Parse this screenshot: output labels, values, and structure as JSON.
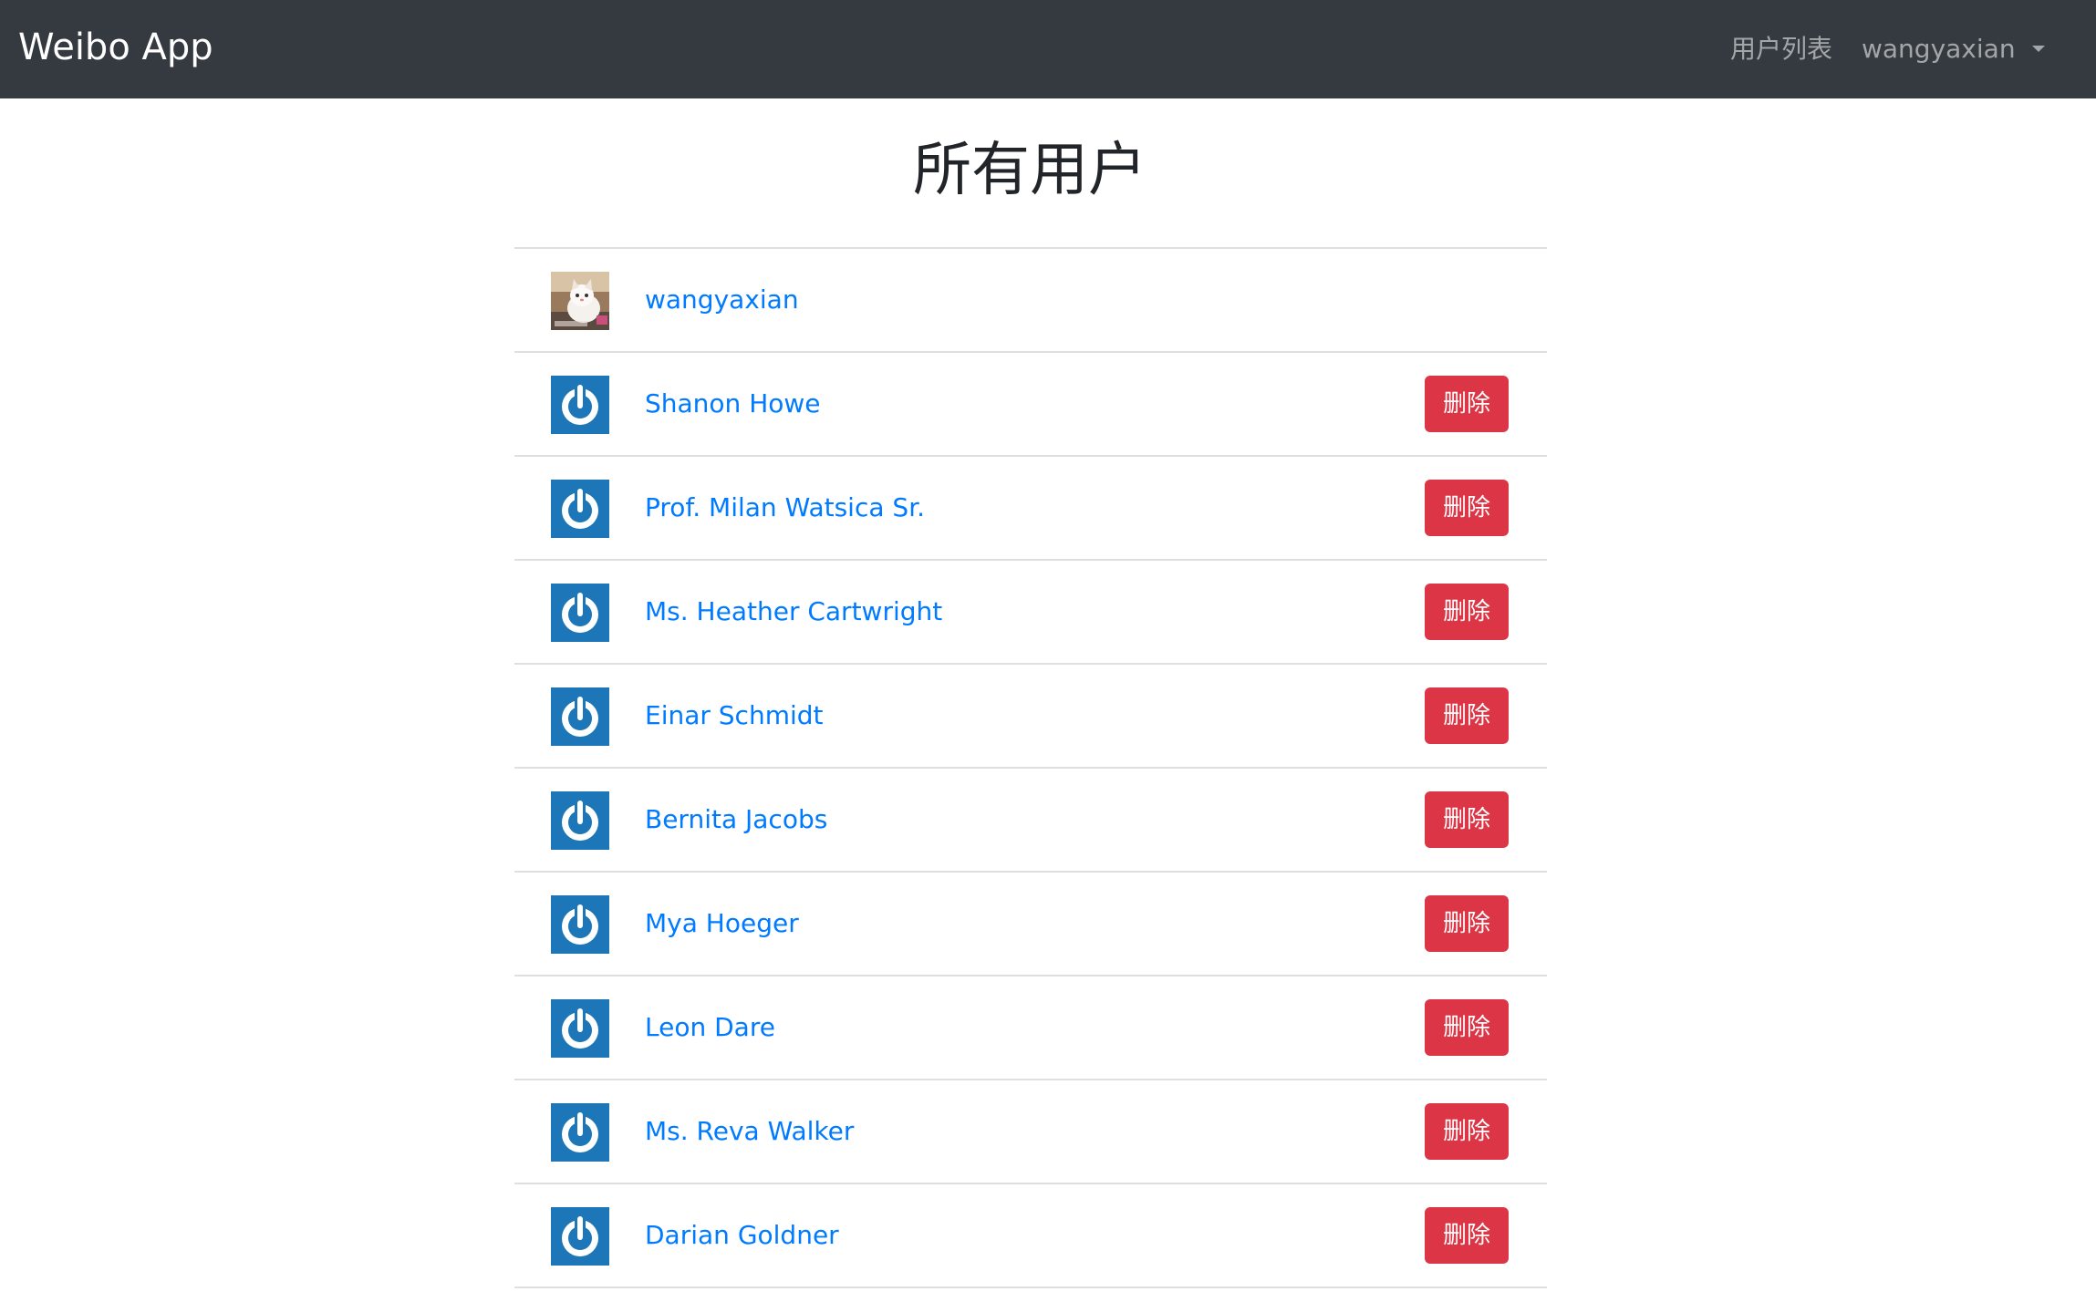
{
  "navbar": {
    "brand": "Weibo App",
    "users_link": "用户列表",
    "account_menu": "wangyaxian"
  },
  "page": {
    "title": "所有用户"
  },
  "colors": {
    "navbar_bg": "#343a40",
    "link": "#007bff",
    "danger": "#dc3545",
    "avatar_bg": "#1c76b8"
  },
  "users": [
    {
      "name": "wangyaxian",
      "avatar": "cat-photo-avatar",
      "can_delete": false
    },
    {
      "name": "Shanon Howe",
      "avatar": "power-icon",
      "can_delete": true,
      "delete_label": "删除"
    },
    {
      "name": "Prof. Milan Watsica Sr.",
      "avatar": "power-icon",
      "can_delete": true,
      "delete_label": "删除"
    },
    {
      "name": "Ms. Heather Cartwright",
      "avatar": "power-icon",
      "can_delete": true,
      "delete_label": "删除"
    },
    {
      "name": "Einar Schmidt",
      "avatar": "power-icon",
      "can_delete": true,
      "delete_label": "删除"
    },
    {
      "name": "Bernita Jacobs",
      "avatar": "power-icon",
      "can_delete": true,
      "delete_label": "删除"
    },
    {
      "name": "Mya Hoeger",
      "avatar": "power-icon",
      "can_delete": true,
      "delete_label": "删除"
    },
    {
      "name": "Leon Dare",
      "avatar": "power-icon",
      "can_delete": true,
      "delete_label": "删除"
    },
    {
      "name": "Ms. Reva Walker",
      "avatar": "power-icon",
      "can_delete": true,
      "delete_label": "删除"
    },
    {
      "name": "Darian Goldner",
      "avatar": "power-icon",
      "can_delete": true,
      "delete_label": "删除"
    }
  ]
}
